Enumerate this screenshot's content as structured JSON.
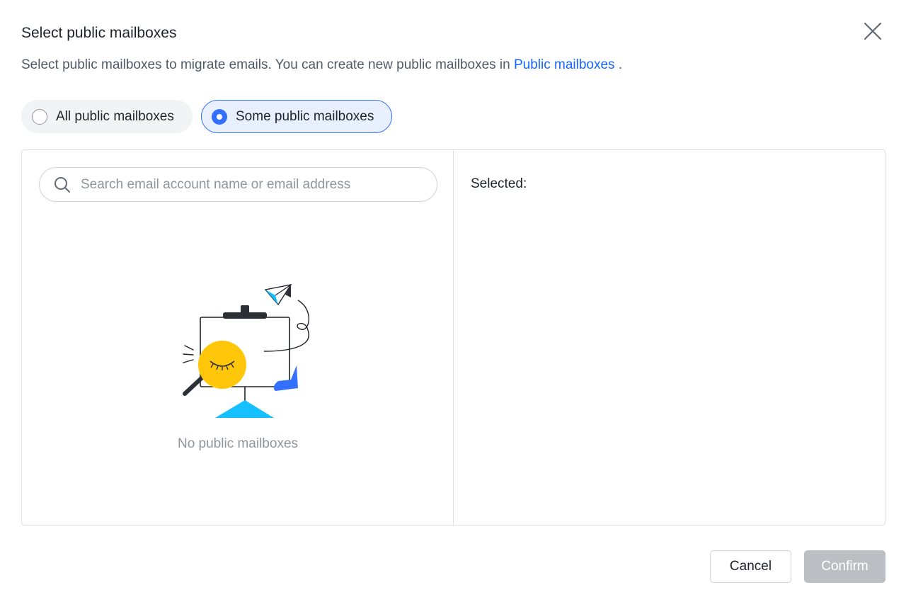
{
  "dialog": {
    "title": "Select public mailboxes",
    "description_text": "Select public mailboxes to migrate emails. You can create new public mailboxes in",
    "description_link": "Public mailboxes",
    "description_suffix": " ."
  },
  "scope_options": [
    {
      "label": "All public mailboxes",
      "checked": false
    },
    {
      "label": "Some public mailboxes",
      "checked": true
    }
  ],
  "search": {
    "placeholder": "Search email account name or email address",
    "value": ""
  },
  "empty_state": {
    "text": "No public mailboxes"
  },
  "selected": {
    "label": "Selected:"
  },
  "footer": {
    "cancel_label": "Cancel",
    "confirm_label": "Confirm"
  },
  "colors": {
    "accent": "#3370ff",
    "link": "#1664ff",
    "disabled_button": "#bbbfc4",
    "illustration_yellow": "#ffc60a",
    "illustration_cyan": "#14c0ff",
    "illustration_blue": "#3370ff"
  }
}
